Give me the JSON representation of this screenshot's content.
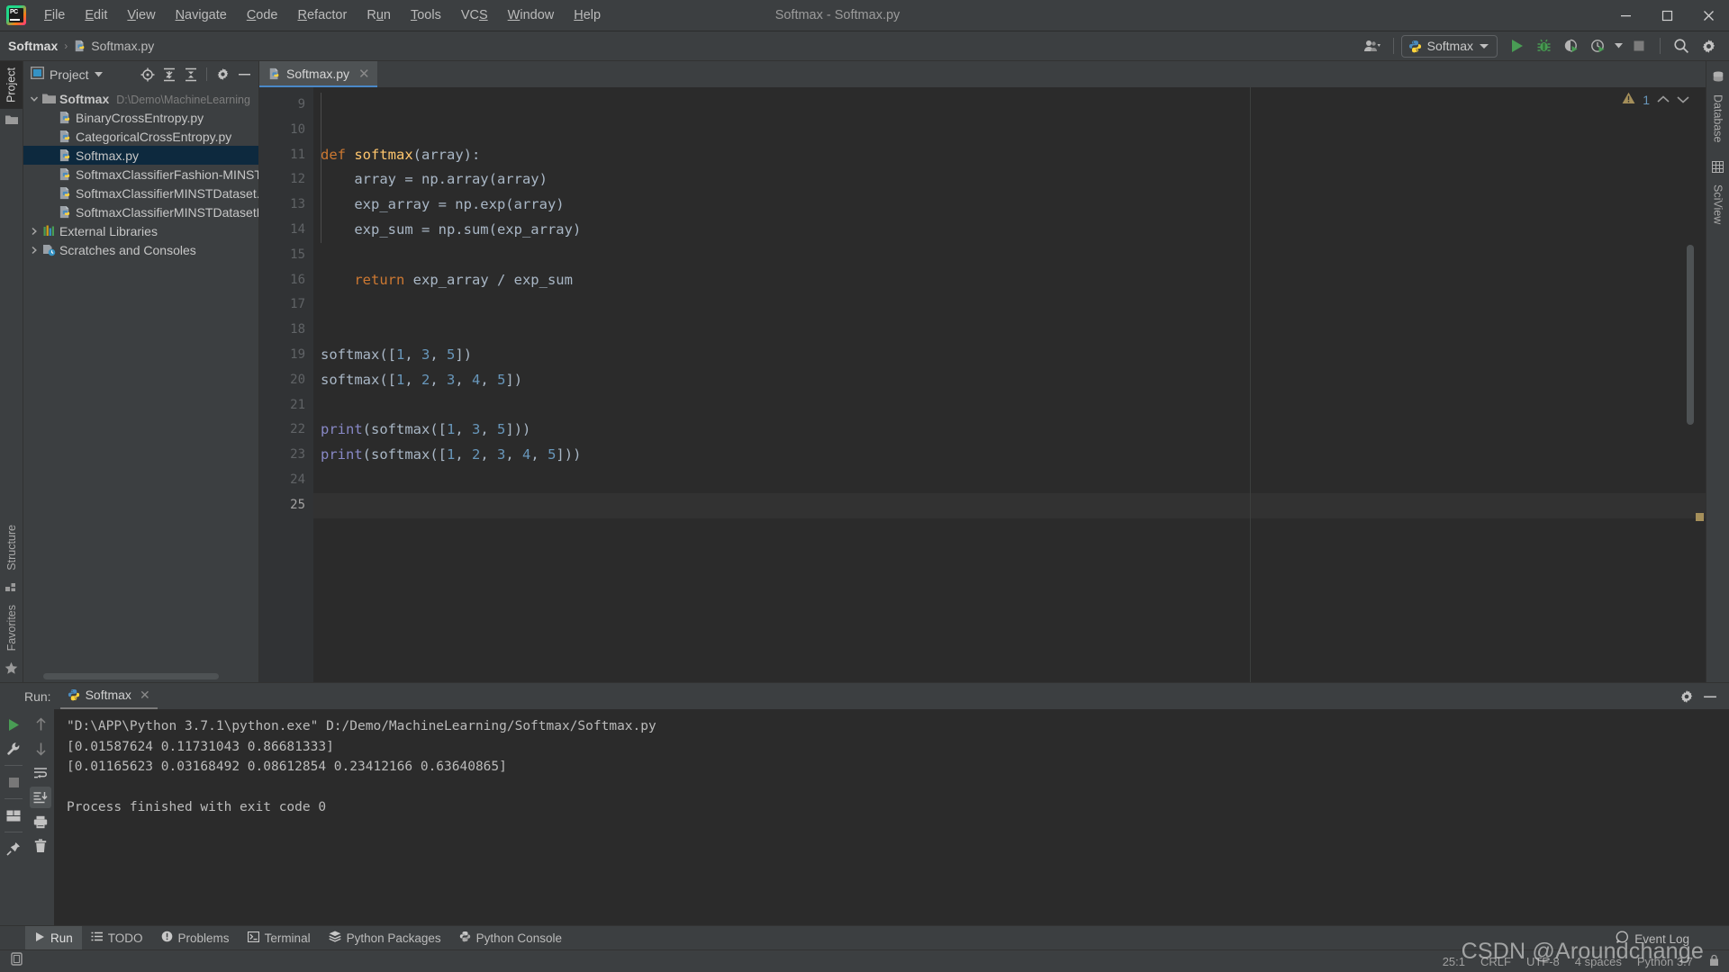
{
  "window": {
    "title": "Softmax - Softmax.py",
    "controls": {
      "minimize": "minimize-icon",
      "maximize": "maximize-icon",
      "close": "close-icon"
    }
  },
  "menubar": {
    "items": [
      {
        "label": "File",
        "mnemonic": "F"
      },
      {
        "label": "Edit",
        "mnemonic": "E"
      },
      {
        "label": "View",
        "mnemonic": "V"
      },
      {
        "label": "Navigate",
        "mnemonic": "N"
      },
      {
        "label": "Code",
        "mnemonic": "C"
      },
      {
        "label": "Refactor",
        "mnemonic": "R"
      },
      {
        "label": "Run",
        "mnemonic": "u"
      },
      {
        "label": "Tools",
        "mnemonic": "T"
      },
      {
        "label": "VCS",
        "mnemonic": "S"
      },
      {
        "label": "Window",
        "mnemonic": "W"
      },
      {
        "label": "Help",
        "mnemonic": "H"
      }
    ]
  },
  "navbar": {
    "breadcrumb": {
      "project": "Softmax",
      "separator": "›",
      "file": "Softmax.py"
    },
    "run_configuration": "Softmax",
    "icons": {
      "account": "account-icon",
      "run": "run-icon",
      "debug": "debug-icon",
      "coverage": "coverage-icon",
      "profile": "profile-icon",
      "profile_dropdown": "chevron-down-icon",
      "stop": "stop-icon",
      "search": "search-icon",
      "settings": "gear-icon"
    }
  },
  "left_rail": {
    "top": [
      {
        "label": "Project",
        "icon": "folder-icon",
        "active": true
      }
    ],
    "bottom": [
      {
        "label": "Structure",
        "icon": "structure-icon"
      },
      {
        "label": "Favorites",
        "icon": "star-icon"
      }
    ]
  },
  "right_rail": [
    {
      "label": "Database",
      "icon": "database-icon"
    },
    {
      "label": "SciView",
      "icon": "sciview-icon"
    }
  ],
  "project_panel": {
    "title": "Project",
    "dropdown": "chevron-down-icon",
    "tools": [
      "locate-icon",
      "expand-all-icon",
      "collapse-all-icon",
      "gear-icon",
      "hide-icon"
    ],
    "tree": [
      {
        "depth": 0,
        "arrow": "expanded",
        "icon": "folder-icon",
        "label": "Softmax",
        "bold": true,
        "path": "D:\\Demo\\MachineLearning",
        "selected": false
      },
      {
        "depth": 1,
        "arrow": "none",
        "icon": "python-file-icon",
        "label": "BinaryCrossEntropy.py",
        "bold": false,
        "path": "",
        "selected": false
      },
      {
        "depth": 1,
        "arrow": "none",
        "icon": "python-file-icon",
        "label": "CategoricalCrossEntropy.py",
        "bold": false,
        "path": "",
        "selected": false
      },
      {
        "depth": 1,
        "arrow": "none",
        "icon": "python-file-icon",
        "label": "Softmax.py",
        "bold": false,
        "path": "",
        "selected": true
      },
      {
        "depth": 1,
        "arrow": "none",
        "icon": "python-file-icon",
        "label": "SoftmaxClassifierFashion-MINSTD",
        "bold": false,
        "path": "",
        "selected": false
      },
      {
        "depth": 1,
        "arrow": "none",
        "icon": "python-file-icon",
        "label": "SoftmaxClassifierMINSTDataset.py",
        "bold": false,
        "path": "",
        "selected": false
      },
      {
        "depth": 1,
        "arrow": "none",
        "icon": "python-file-icon",
        "label": "SoftmaxClassifierMINSTDatasetKe",
        "bold": false,
        "path": "",
        "selected": false
      },
      {
        "depth": 0,
        "arrow": "collapsed",
        "icon": "libraries-icon",
        "label": "External Libraries",
        "bold": false,
        "path": "",
        "selected": false
      },
      {
        "depth": 0,
        "arrow": "collapsed",
        "icon": "scratches-icon",
        "label": "Scratches and Consoles",
        "bold": false,
        "path": "",
        "selected": false
      }
    ]
  },
  "editor": {
    "tab": {
      "label": "Softmax.py",
      "icon": "python-file-icon",
      "close": "close-icon"
    },
    "first_line_number": 9,
    "last_line_number": 25,
    "current_line": 25,
    "lines": [
      {
        "n": 9,
        "text": ""
      },
      {
        "n": 10,
        "text": ""
      },
      {
        "n": 11,
        "text": "def softmax(array):",
        "fold": "open"
      },
      {
        "n": 12,
        "text": "    array = np.array(array)"
      },
      {
        "n": 13,
        "text": "    exp_array = np.exp(array)"
      },
      {
        "n": 14,
        "text": "    exp_sum = np.sum(exp_array)"
      },
      {
        "n": 15,
        "text": ""
      },
      {
        "n": 16,
        "text": "    return exp_array / exp_sum",
        "fold": "end"
      },
      {
        "n": 17,
        "text": ""
      },
      {
        "n": 18,
        "text": ""
      },
      {
        "n": 19,
        "text": "softmax([1, 3, 5])"
      },
      {
        "n": 20,
        "text": "softmax([1, 2, 3, 4, 5])"
      },
      {
        "n": 21,
        "text": ""
      },
      {
        "n": 22,
        "text": "print(softmax([1, 3, 5]))"
      },
      {
        "n": 23,
        "text": "print(softmax([1, 2, 3, 4, 5]))"
      },
      {
        "n": 24,
        "text": ""
      },
      {
        "n": 25,
        "text": ""
      }
    ],
    "inspection": {
      "icon": "warning-icon",
      "count": "1",
      "prev": "chevron-up-icon",
      "next": "chevron-down-icon"
    }
  },
  "run_panel": {
    "label": "Run:",
    "tab": {
      "label": "Softmax",
      "icon": "python-icon",
      "close": "close-icon"
    },
    "header_icons": [
      "gear-icon",
      "hide-icon"
    ],
    "rail_primary": [
      "rerun-icon",
      "wrench-icon",
      "stop-icon",
      "layout-icon",
      "pin-icon"
    ],
    "rail_secondary": [
      "arrow-up-icon",
      "arrow-down-icon",
      "soft-wrap-icon",
      "scroll-to-end-icon",
      "print-icon",
      "trash-icon"
    ],
    "console": [
      "\"D:\\APP\\Python 3.7.1\\python.exe\" D:/Demo/MachineLearning/Softmax/Softmax.py",
      "[0.01587624 0.11731043 0.86681333]",
      "[0.01165623 0.03168492 0.08612854 0.23412166 0.63640865]",
      "",
      "Process finished with exit code 0"
    ]
  },
  "bottom_bar": [
    {
      "label": "Run",
      "icon": "run-icon",
      "active": true
    },
    {
      "label": "TODO",
      "icon": "todo-icon",
      "active": false
    },
    {
      "label": "Problems",
      "icon": "problems-icon",
      "active": false
    },
    {
      "label": "Terminal",
      "icon": "terminal-icon",
      "active": false
    },
    {
      "label": "Python Packages",
      "icon": "packages-icon",
      "active": false
    },
    {
      "label": "Python Console",
      "icon": "python-icon",
      "active": false
    }
  ],
  "status_bar": {
    "event_log": {
      "label": "Event Log",
      "icon": "event-log-icon"
    },
    "caret_position": "25:1",
    "line_separator": "CRLF",
    "encoding": "UTF-8",
    "indent": "4 spaces",
    "interpreter": "Python 3.7",
    "lock": "lock-icon"
  },
  "watermark": "CSDN @Aroundchange",
  "colors": {
    "bg_chrome": "#3c3f41",
    "bg_editor": "#2b2b2b",
    "bg_gutter": "#313335",
    "selection": "#0d293e",
    "accent_blue": "#4a88c7",
    "run_green": "#499c54",
    "keyword_orange": "#cc7832",
    "function_yellow": "#ffc66d",
    "number_blue": "#6897bb",
    "builtin_purple": "#8888c6",
    "text_default": "#a9b7c6",
    "warning_amber": "#a58f5a"
  }
}
